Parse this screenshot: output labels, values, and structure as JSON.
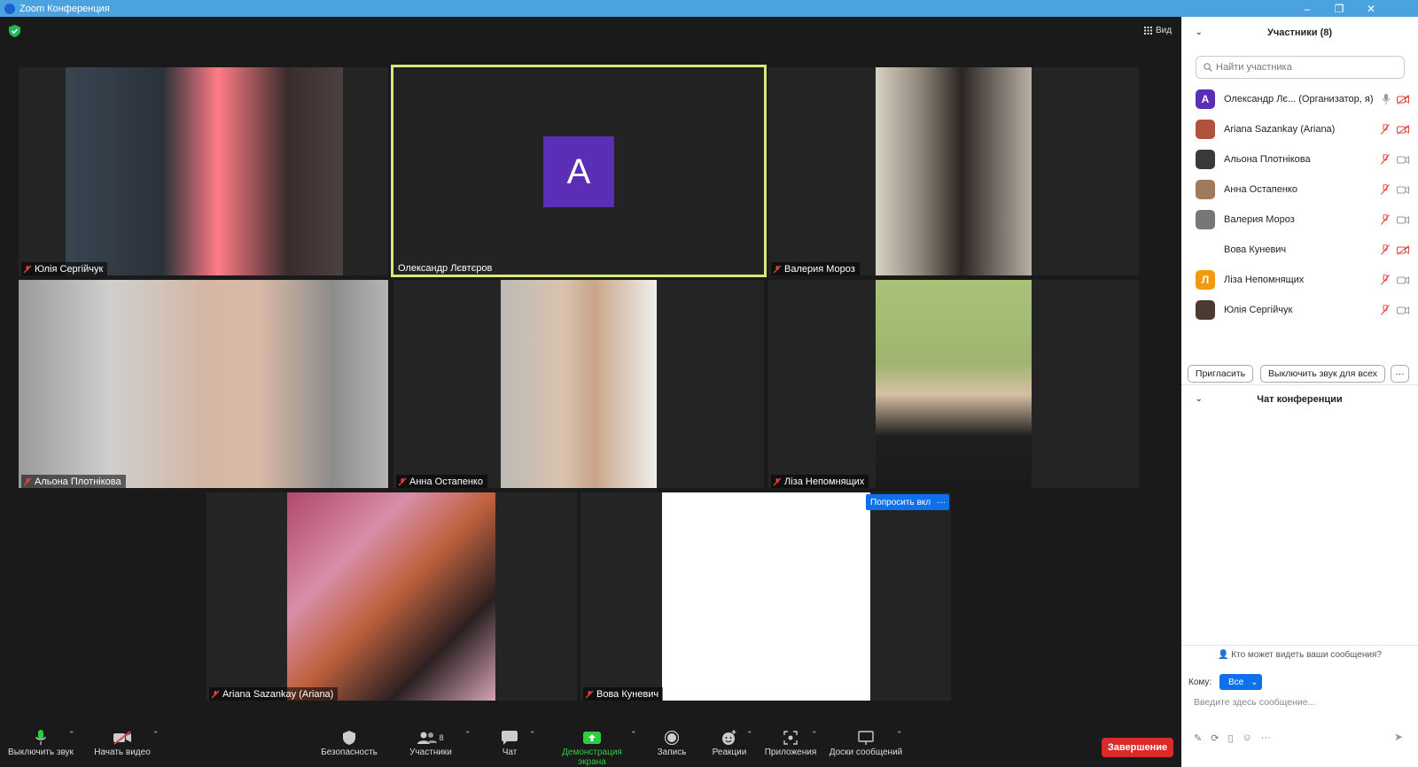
{
  "window": {
    "title": "Zoom Конференция",
    "minimize": "–",
    "restore": "❐",
    "close": "✕"
  },
  "stage": {
    "view_label": "Вид"
  },
  "tiles": [
    {
      "name": "Юлія Сергійчук"
    },
    {
      "name": "Олександр Лєвтєров",
      "avatar_letter": "А"
    },
    {
      "name": "Валерия Мороз"
    },
    {
      "name": "Альона Плотнікова"
    },
    {
      "name": "Анна Остапенко"
    },
    {
      "name": "Ліза Непомнящих"
    },
    {
      "name": "Ariana Sazankay (Ariana)"
    },
    {
      "name": "Вова Куневич",
      "ask_button": "Попросить вкл",
      "more": "···"
    }
  ],
  "toolbar": {
    "mute": "Выключить звук",
    "video": "Начать видео",
    "security": "Безопасность",
    "participants": "Участники",
    "participants_count": "8",
    "chat": "Чат",
    "share": "Демонстрация экрана",
    "record": "Запись",
    "reactions": "Реакции",
    "apps": "Приложения",
    "whiteboards": "Доски сообщений",
    "end": "Завершение"
  },
  "panel": {
    "participants_title": "Участники (8)",
    "search_placeholder": "Найти участника",
    "participants": [
      {
        "name": "Олександр Лє... (Организатор, я)",
        "avatar": "А",
        "color": "#5b2fb5"
      },
      {
        "name": "Ariana Sazankay (Ariana)",
        "avatar": "",
        "color": "#b0533c"
      },
      {
        "name": "Альона Плотнікова",
        "avatar": "",
        "color": "#3a3a3a"
      },
      {
        "name": "Анна Остапенко",
        "avatar": "",
        "color": "#a07a5a"
      },
      {
        "name": "Валерия Мороз",
        "avatar": "",
        "color": "#777777"
      },
      {
        "name": "Вова Куневич",
        "avatar": "",
        "color": "#ffffff"
      },
      {
        "name": "Ліза Непомнящих",
        "avatar": "Л",
        "color": "#f29a12"
      },
      {
        "name": "Юлія Сергійчук",
        "avatar": "",
        "color": "#4a3a32"
      }
    ],
    "invite": "Пригласить",
    "mute_all": "Выключить звук для всех",
    "more": "···",
    "chat_title": "Чат конференции",
    "who_can_see": "Кто может видеть ваши сообщения?",
    "to_label": "Кому:",
    "to_value": "Все",
    "message_placeholder": "Введите здесь сообщение..."
  }
}
